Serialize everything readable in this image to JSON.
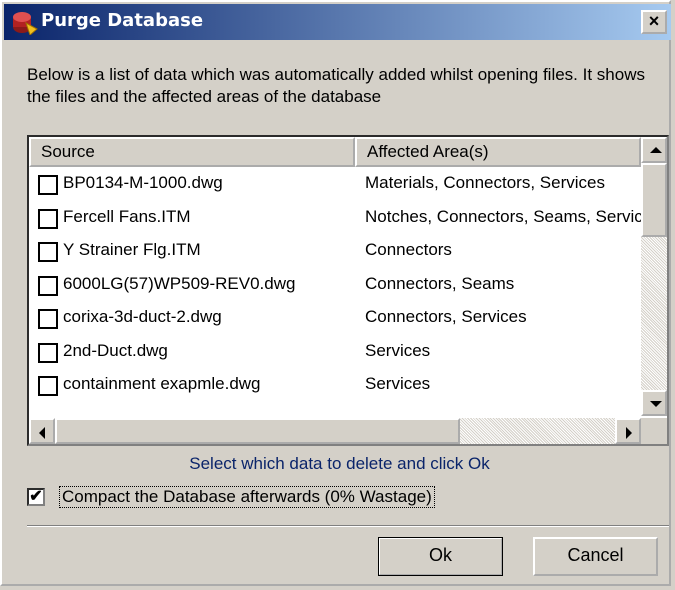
{
  "window": {
    "title": "Purge Database",
    "close_label": "×"
  },
  "description": "Below is a list of data which was automatically added whilst opening files. It shows the files and the affected areas of the database",
  "list": {
    "columns": [
      "Source",
      "Affected Area(s)"
    ],
    "rows": [
      {
        "source": "BP0134-M-1000.dwg",
        "area": "Materials, Connectors, Services",
        "checked": false
      },
      {
        "source": "Fercell Fans.ITM",
        "area": "Notches, Connectors, Seams, Services",
        "checked": false
      },
      {
        "source": "Y Strainer Flg.ITM",
        "area": "Connectors",
        "checked": false
      },
      {
        "source": "6000LG(57)WP509-REV0.dwg",
        "area": "Connectors, Seams",
        "checked": false
      },
      {
        "source": "corixa-3d-duct-2.dwg",
        "area": "Connectors, Services",
        "checked": false
      },
      {
        "source": "2nd-Duct.dwg",
        "area": "Services",
        "checked": false
      },
      {
        "source": "containment exapmle.dwg",
        "area": "Services",
        "checked": false
      }
    ]
  },
  "hint": "Select which data to delete and click Ok",
  "compact": {
    "label": "Compact the Database afterwards (0% Wastage)",
    "checked": true,
    "mark": "✔"
  },
  "buttons": {
    "ok": "Ok",
    "cancel": "Cancel"
  }
}
